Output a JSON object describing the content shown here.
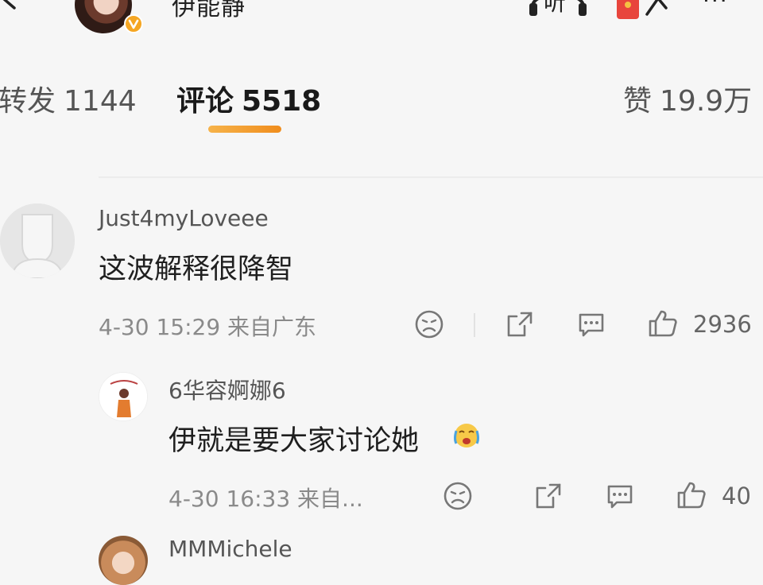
{
  "header": {
    "name": "伊能静",
    "listen_label": "听",
    "more_label": "···"
  },
  "tabs": {
    "repost": {
      "label": "转发",
      "count": "1144"
    },
    "comment": {
      "label": "评论",
      "count": "5518"
    },
    "like": {
      "label": "赞",
      "count": "19.9万"
    }
  },
  "comments": [
    {
      "user": "Just4myLoveee",
      "text": "这波解释很降智",
      "time": "4-30 15:29",
      "location": "来自广东",
      "likes": "2936"
    },
    {
      "user": "6华容婀娜6",
      "text": "伊就是要大家讨论她",
      "time": "4-30 16:33",
      "location": "来自...",
      "likes": "40"
    },
    {
      "user": "MMMichele"
    }
  ],
  "colors": {
    "accent": "#f5a623",
    "background": "#f6f6f6",
    "text_primary": "#1f1f1f",
    "text_secondary": "#8a8a8a"
  },
  "icons": [
    "back-icon",
    "verified-badge-icon",
    "headphones-icon",
    "red-packet-icon",
    "share-icon",
    "dislike-icon",
    "comment-icon",
    "like-icon",
    "crying-emoji-icon"
  ]
}
